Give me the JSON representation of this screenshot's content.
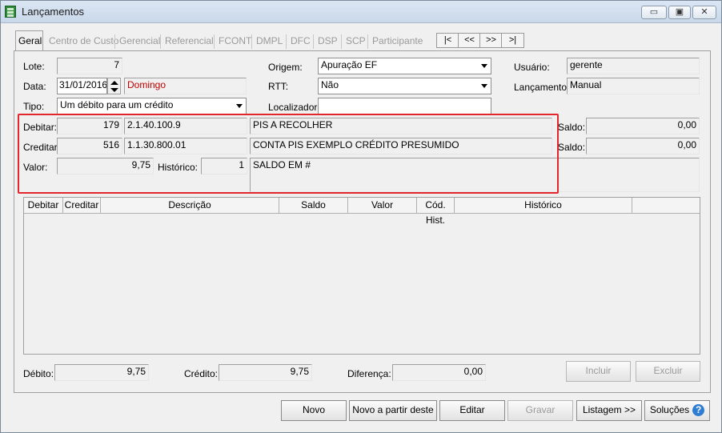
{
  "window": {
    "title": "Lançamentos",
    "minimize": "▭",
    "maximize": "▣",
    "close": "✕"
  },
  "tabs": [
    "Geral",
    "Centro de Custo",
    "Gerencial",
    "Referencial",
    "FCONT",
    "DMPL",
    "DFC",
    "DSP",
    "SCP",
    "Participante"
  ],
  "nav": {
    "first": "|<",
    "prev": "<<",
    "next": ">>",
    "last": ">|"
  },
  "form": {
    "lote_label": "Lote:",
    "lote_value": "7",
    "data_label": "Data:",
    "data_value": "31/01/2016",
    "weekday": "Domingo",
    "tipo_label": "Tipo:",
    "tipo_value": "Um débito para um crédito",
    "origem_label": "Origem:",
    "origem_value": "Apuração EF",
    "rtt_label": "RTT:",
    "rtt_value": "Não",
    "localizador_label": "Localizador:",
    "localizador_value": "",
    "usuario_label": "Usuário:",
    "usuario_value": "gerente",
    "lancamento_label": "Lançamento:",
    "lancamento_value": "Manual"
  },
  "entry": {
    "debitar_label": "Debitar:",
    "debitar_code": "179",
    "debitar_account": "2.1.40.100.9",
    "debitar_name": "PIS A RECOLHER",
    "creditar_label": "Creditar:",
    "creditar_code": "516",
    "creditar_account": "1.1.30.800.01",
    "creditar_name": "CONTA PIS EXEMPLO CRÉDITO PRESUMIDO",
    "valor_label": "Valor:",
    "valor_value": "9,75",
    "historico_label": "Histórico:",
    "historico_code": "1",
    "historico_text": "SALDO EM #",
    "saldo_label": "Saldo:",
    "saldo_debitar": "0,00",
    "saldo_creditar": "0,00"
  },
  "grid": {
    "columns": [
      "Debitar",
      "Creditar",
      "Descrição",
      "Saldo",
      "Valor",
      "Cód. Hist.",
      "Histórico"
    ]
  },
  "totals": {
    "debito_label": "Débito:",
    "debito_value": "9,75",
    "credito_label": "Crédito:",
    "credito_value": "9,75",
    "diferenca_label": "Diferença:",
    "diferenca_value": "0,00",
    "incluir": "Incluir",
    "excluir": "Excluir"
  },
  "buttons": {
    "novo": "Novo",
    "novo_partir": "Novo a partir deste",
    "editar": "Editar",
    "gravar": "Gravar",
    "listagem": "Listagem >>",
    "solucoes": "Soluções"
  },
  "colors": {
    "highlight": "#e2262e",
    "weekday": "#c00000",
    "help": "#2d7dd2"
  }
}
